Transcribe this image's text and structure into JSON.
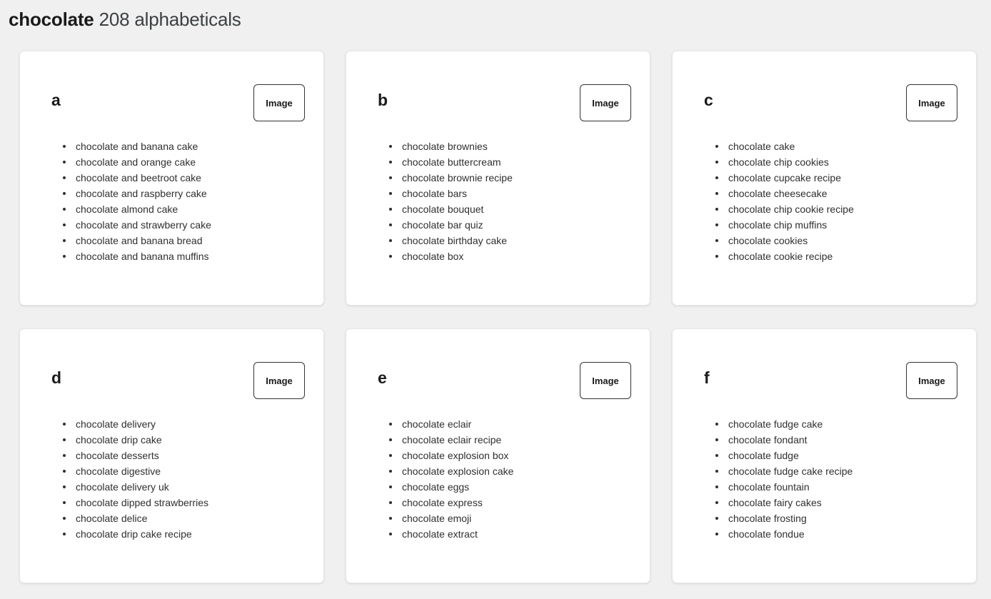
{
  "header": {
    "keyword": "chocolate",
    "summary": " 208 alphabeticals"
  },
  "theme": {
    "background": "#eff0ef",
    "card_background": "#ffffff",
    "card_border": "#e6e6e6",
    "text": "#2f2f2f",
    "heading": "#1a1a1a"
  },
  "image_label": "Image",
  "cards": [
    {
      "letter": "a",
      "image_label": "Image",
      "items": [
        "chocolate and banana cake",
        "chocolate and orange cake",
        "chocolate and beetroot cake",
        "chocolate and raspberry cake",
        "chocolate almond cake",
        "chocolate and strawberry cake",
        "chocolate and banana bread",
        "chocolate and banana muffins"
      ]
    },
    {
      "letter": "b",
      "image_label": "Image",
      "items": [
        "chocolate brownies",
        "chocolate buttercream",
        "chocolate brownie recipe",
        "chocolate bars",
        "chocolate bouquet",
        "chocolate bar quiz",
        "chocolate birthday cake",
        "chocolate box"
      ]
    },
    {
      "letter": "c",
      "image_label": "Image",
      "items": [
        "chocolate cake",
        "chocolate chip cookies",
        "chocolate cupcake recipe",
        "chocolate cheesecake",
        "chocolate chip cookie recipe",
        "chocolate chip muffins",
        "chocolate cookies",
        "chocolate cookie recipe"
      ]
    },
    {
      "letter": "d",
      "image_label": "Image",
      "items": [
        "chocolate delivery",
        "chocolate drip cake",
        "chocolate desserts",
        "chocolate digestive",
        "chocolate delivery uk",
        "chocolate dipped strawberries",
        "chocolate delice",
        "chocolate drip cake recipe"
      ]
    },
    {
      "letter": "e",
      "image_label": "Image",
      "items": [
        "chocolate eclair",
        "chocolate eclair recipe",
        "chocolate explosion box",
        "chocolate explosion cake",
        "chocolate eggs",
        "chocolate express",
        "chocolate emoji",
        "chocolate extract"
      ]
    },
    {
      "letter": "f",
      "image_label": "Image",
      "items": [
        "chocolate fudge cake",
        "chocolate fondant",
        "chocolate fudge",
        "chocolate fudge cake recipe",
        "chocolate fountain",
        "chocolate fairy cakes",
        "chocolate frosting",
        "chocolate fondue"
      ]
    }
  ]
}
